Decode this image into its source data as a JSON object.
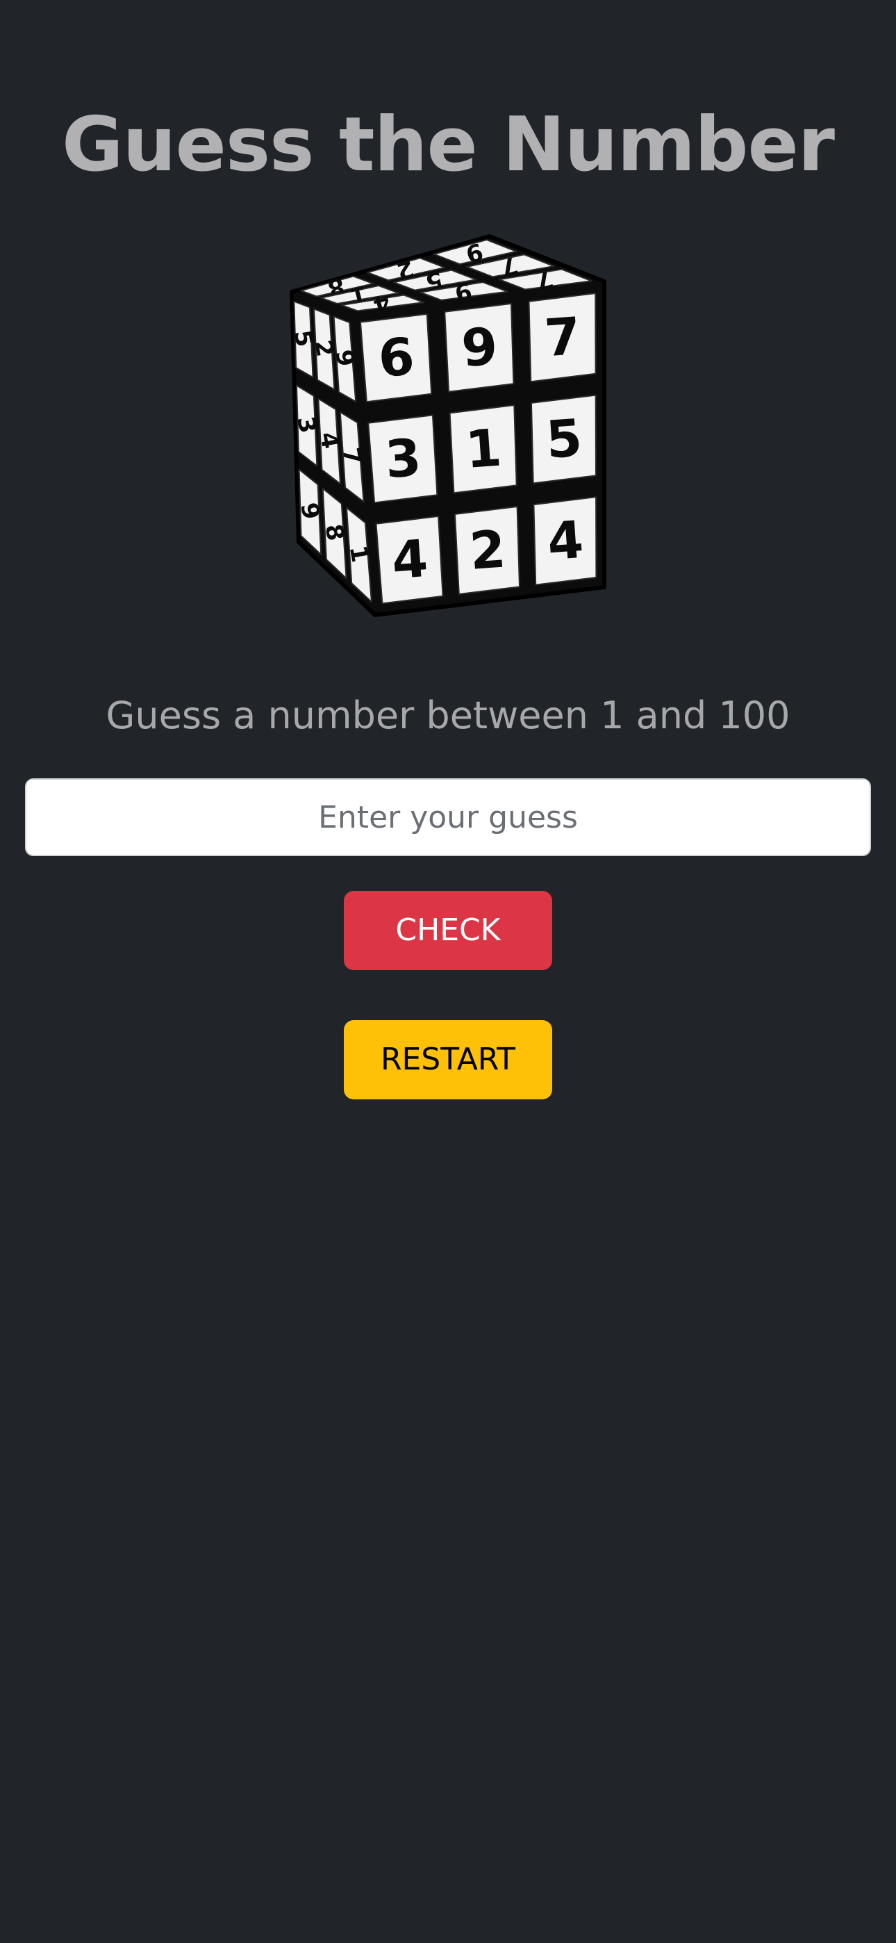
{
  "header": {
    "title": "Guess the Number"
  },
  "image": {
    "name": "sudoku-cube",
    "description_icon": "rubiks-cube-icon"
  },
  "game": {
    "prompt": "Guess a number between 1 and 100",
    "input_placeholder": "Enter your guess",
    "input_value": ""
  },
  "actions": {
    "check_label": "CHECK",
    "restart_label": "RESTART"
  },
  "colors": {
    "background": "#212428",
    "check": "#dc3545",
    "restart": "#ffc107"
  },
  "cube_faces": {
    "top": [
      "8",
      "2",
      "9",
      "1",
      "5",
      "7",
      "4",
      "9",
      "7"
    ],
    "front": [
      "6",
      "9",
      "7",
      "3",
      "1",
      "5",
      "4",
      "2",
      "4"
    ],
    "left": [
      "5",
      "2",
      "9",
      "3",
      "4",
      "7",
      "9",
      "8",
      "1"
    ]
  }
}
